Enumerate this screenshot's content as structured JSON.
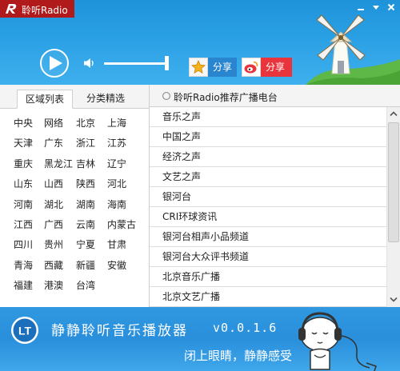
{
  "app": {
    "title": "聆听Radio"
  },
  "player": {
    "share_qq_label": "分享",
    "share_weibo_label": "分享"
  },
  "tabs": [
    {
      "label": "区域列表",
      "active": true
    },
    {
      "label": "分类精选",
      "active": false
    }
  ],
  "provinces": [
    [
      "中央",
      "网络",
      "北京",
      "上海"
    ],
    [
      "天津",
      "广东",
      "浙江",
      "江苏"
    ],
    [
      "重庆",
      "黑龙江",
      "吉林",
      "辽宁"
    ],
    [
      "山东",
      "山西",
      "陕西",
      "河北"
    ],
    [
      "河南",
      "湖北",
      "湖南",
      "海南"
    ],
    [
      "江西",
      "广西",
      "云南",
      "内蒙古"
    ],
    [
      "四川",
      "贵州",
      "宁夏",
      "甘肃"
    ],
    [
      "青海",
      "西藏",
      "新疆",
      "安徽"
    ],
    [
      "福建",
      "港澳",
      "台湾"
    ]
  ],
  "station_panel": {
    "header": "聆听Radio推荐广播电台",
    "stations": [
      "音乐之声",
      "中国之声",
      "经济之声",
      "文艺之声",
      "银河台",
      "CRI环球资讯",
      "银河台相声小品频道",
      "银河台大众评书频道",
      "北京音乐广播",
      "北京文艺广播"
    ]
  },
  "footer": {
    "logo_text": "LT",
    "title": "静静聆听音乐播放器",
    "version": "v0.0.1.6",
    "slogan": "闭上眼睛，静静感受"
  },
  "colors": {
    "header_blue": "#2aa0e4",
    "title_red": "#b01a1a",
    "qq_blue": "#2a85cf",
    "weibo_red": "#e8343c",
    "footer_blue": "#2a8fdc"
  },
  "icons": {
    "logo": "r-logo-icon",
    "minimize": "minimize-icon",
    "options": "dropdown-icon",
    "close": "close-icon",
    "play": "play-icon",
    "volume": "speaker-icon",
    "qq_share": "star-icon",
    "weibo_share": "weibo-icon"
  }
}
